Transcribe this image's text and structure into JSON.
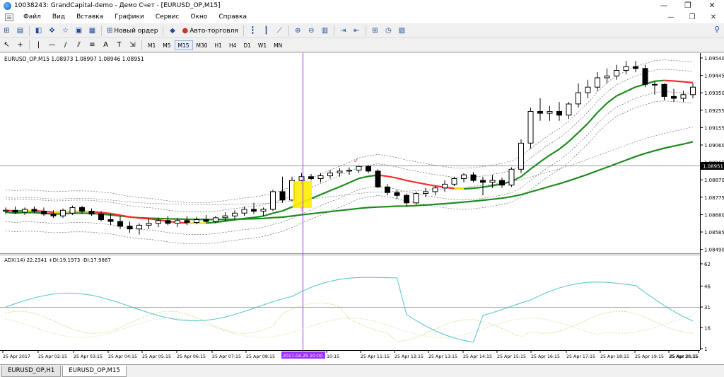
{
  "window": {
    "title": "10038243: GrandCapital-demo - Демо Счет - [EURUSD_OP,M15]",
    "minimize": "—",
    "maximize": "❐",
    "close": "✕"
  },
  "menu": {
    "items": [
      "Файл",
      "Вид",
      "Вставка",
      "Графики",
      "Сервис",
      "Окно",
      "Справка"
    ],
    "right_controls": [
      "—",
      "❐",
      "✕"
    ]
  },
  "toolbar": {
    "new_order_label": "Новый ордер",
    "autotrading_label": "Авто-торговля",
    "timeframes": [
      "M1",
      "M5",
      "M15",
      "M30",
      "H1",
      "H4",
      "D1",
      "W1",
      "MN"
    ],
    "selected_timeframe": "M15"
  },
  "chart": {
    "info_label": "EURUSD_OP,M15  1.08973 1.08997 1.08946 1.08951",
    "price_labels": [
      "1.09540",
      "1.09445",
      "1.09350",
      "1.09255",
      "1.09155",
      "1.09060",
      "1.08965",
      "1.08870",
      "1.08775",
      "1.08680",
      "1.08585",
      "1.08490"
    ],
    "current_price": "1.08951",
    "indicator_label": "ADX(14) 22.2341 +DI:19.1973 -DI:17.9867",
    "indicator_scale": [
      "62",
      "46",
      "31",
      "16",
      "1"
    ],
    "time_labels": [
      "25 Apr 2017",
      "25 Apr 02:15",
      "25 Apr 03:15",
      "25 Apr 04:15",
      "25 Apr 05:15",
      "25 Apr 06:15",
      "25 Apr 07:15",
      "25 Apr 08:15",
      "2017.04.25 10:00",
      "10:15",
      "25 Apr 11:15",
      "25 Apr 12:15",
      "25 Apr 13:15",
      "25 Apr 14:15",
      "25 Apr 15:15",
      "25 Apr 16:15",
      "25 Apr 17:15",
      "25 Apr 18:15",
      "25 Apr 19:15",
      "25 Apr 20:15",
      "25 Apr 21:15"
    ],
    "colors": {
      "ma_fast": "#1f8a1f",
      "ma_signal_down": "#ff2a2a",
      "ma_signal_flat": "#ffd400",
      "crosshair": "#9b30ff",
      "adx_line": "#5fc9c9",
      "di_plus": "#d6d67a",
      "di_minus": "#cfe6b0",
      "highlight_box": "#ffee00"
    }
  },
  "tabs": [
    "EURUSD_OP,H1",
    "EURUSD_OP,M15"
  ],
  "active_tab": "EURUSD_OP,M15",
  "chart_data": {
    "type": "candlestick",
    "symbol": "EURUSD_OP",
    "timeframe": "M15",
    "ylim": [
      1.0849,
      1.0954
    ],
    "subwindow": {
      "name": "ADX(14)",
      "ylim": [
        1,
        62
      ],
      "level": 31
    },
    "candles": [
      [
        1.08715,
        1.08735,
        1.087,
        1.0872
      ],
      [
        1.0872,
        1.0874,
        1.087,
        1.0871
      ],
      [
        1.0871,
        1.08735,
        1.08695,
        1.08725
      ],
      [
        1.08725,
        1.0874,
        1.08705,
        1.08715
      ],
      [
        1.08715,
        1.08735,
        1.0869,
        1.087
      ],
      [
        1.087,
        1.0872,
        1.0868,
        1.0869
      ],
      [
        1.0869,
        1.0873,
        1.0868,
        1.0872
      ],
      [
        1.08705,
        1.08745,
        1.08695,
        1.08735
      ],
      [
        1.08735,
        1.08745,
        1.087,
        1.08715
      ],
      [
        1.08715,
        1.0873,
        1.0869,
        1.087
      ],
      [
        1.087,
        1.08715,
        1.0866,
        1.0867
      ],
      [
        1.0867,
        1.087,
        1.0864,
        1.0866
      ],
      [
        1.0866,
        1.0869,
        1.0862,
        1.08635
      ],
      [
        1.08635,
        1.0866,
        1.086,
        1.0862
      ],
      [
        1.0862,
        1.0865,
        1.0859,
        1.0864
      ],
      [
        1.0864,
        1.0868,
        1.0862,
        1.0865
      ],
      [
        1.0865,
        1.0868,
        1.0863,
        1.08665
      ],
      [
        1.08665,
        1.0869,
        1.0864,
        1.0865
      ],
      [
        1.0865,
        1.0868,
        1.0863,
        1.08665
      ],
      [
        1.08665,
        1.0869,
        1.0864,
        1.08655
      ],
      [
        1.08655,
        1.08685,
        1.08645,
        1.0867
      ],
      [
        1.0867,
        1.08695,
        1.08655,
        1.0866
      ],
      [
        1.0866,
        1.0869,
        1.0865,
        1.0868
      ],
      [
        1.0868,
        1.0871,
        1.0866,
        1.0869
      ],
      [
        1.0869,
        1.0872,
        1.0867,
        1.08705
      ],
      [
        1.08705,
        1.0874,
        1.0869,
        1.08725
      ],
      [
        1.08725,
        1.0876,
        1.087,
        1.08715
      ],
      [
        1.08715,
        1.08735,
        1.0869,
        1.08725
      ],
      [
        1.08725,
        1.0883,
        1.08715,
        1.0882
      ],
      [
        1.0882,
        1.089,
        1.0876,
        1.08775
      ],
      [
        1.08775,
        1.089,
        1.0877,
        1.0888
      ],
      [
        1.0888,
        1.0892,
        1.0886,
        1.089
      ],
      [
        1.089,
        1.08915,
        1.0888,
        1.0889
      ],
      [
        1.0889,
        1.0892,
        1.0887,
        1.08905
      ],
      [
        1.08905,
        1.08935,
        1.0889,
        1.0892
      ],
      [
        1.0892,
        1.08945,
        1.089,
        1.0893
      ],
      [
        1.0893,
        1.0895,
        1.0891,
        1.08935
      ],
      [
        1.08935,
        1.0896,
        1.0892,
        1.08955
      ],
      [
        1.08955,
        1.08965,
        1.0892,
        1.0893
      ],
      [
        1.0893,
        1.0894,
        1.0884,
        1.08845
      ],
      [
        1.08845,
        1.0886,
        1.088,
        1.08815
      ],
      [
        1.08815,
        1.0883,
        1.0878,
        1.088
      ],
      [
        1.088,
        1.0881,
        1.0874,
        1.0876
      ],
      [
        1.0876,
        1.0882,
        1.0875,
        1.0881
      ],
      [
        1.0881,
        1.0884,
        1.0879,
        1.0882
      ],
      [
        1.0882,
        1.0885,
        1.088,
        1.0884
      ],
      [
        1.0884,
        1.0888,
        1.0882,
        1.0886
      ],
      [
        1.0886,
        1.089,
        1.0885,
        1.0889
      ],
      [
        1.0889,
        1.0892,
        1.0887,
        1.0891
      ],
      [
        1.0891,
        1.08925,
        1.0887,
        1.0888
      ],
      [
        1.0888,
        1.089,
        1.088,
        1.0887
      ],
      [
        1.0887,
        1.0891,
        1.0884,
        1.0888
      ],
      [
        1.0888,
        1.08895,
        1.0884,
        1.08855
      ],
      [
        1.08855,
        1.0895,
        1.08845,
        1.0894
      ],
      [
        1.0894,
        1.091,
        1.0892,
        1.0908
      ],
      [
        1.0908,
        1.0927,
        1.0905,
        1.0925
      ],
      [
        1.0925,
        1.0932,
        1.092,
        1.0924
      ],
      [
        1.0924,
        1.0928,
        1.092,
        1.0925
      ],
      [
        1.0925,
        1.093,
        1.092,
        1.0923
      ],
      [
        1.0923,
        1.093,
        1.0921,
        1.0929
      ],
      [
        1.0929,
        1.094,
        1.0927,
        1.0935
      ],
      [
        1.0935,
        1.0942,
        1.0932,
        1.0938
      ],
      [
        1.0938,
        1.0946,
        1.0936,
        1.0943
      ],
      [
        1.0943,
        1.0948,
        1.094,
        1.0944
      ],
      [
        1.0944,
        1.095,
        1.0942,
        1.0947
      ],
      [
        1.0947,
        1.0952,
        1.0945,
        1.0949
      ],
      [
        1.0949,
        1.0952,
        1.0946,
        1.0948
      ],
      [
        1.0948,
        1.095,
        1.0938,
        1.09395
      ],
      [
        1.09395,
        1.0941,
        1.0934,
        1.09395
      ],
      [
        1.09395,
        1.094,
        1.0931,
        1.0933
      ],
      [
        1.0933,
        1.0937,
        1.093,
        1.0932
      ],
      [
        1.0932,
        1.0936,
        1.093,
        1.0934
      ],
      [
        1.0934,
        1.094,
        1.0932,
        1.0938
      ]
    ]
  }
}
